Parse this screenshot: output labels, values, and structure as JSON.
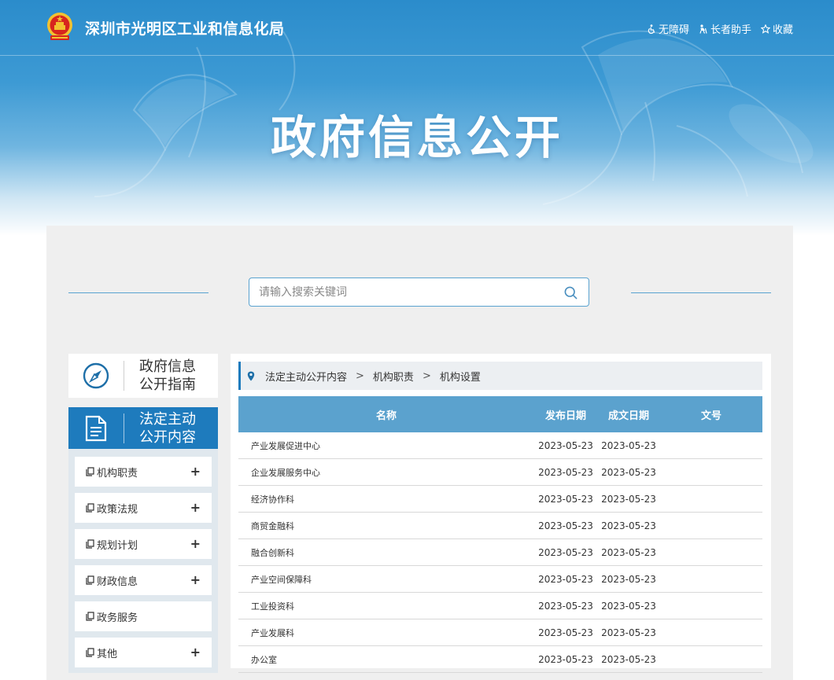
{
  "header": {
    "org_name": "深圳市光明区工业和信息化局",
    "links": [
      {
        "label": "无障碍",
        "icon": "accessibility-icon"
      },
      {
        "label": "长者助手",
        "icon": "elder-assistant-icon"
      },
      {
        "label": "收藏",
        "icon": "star-icon"
      }
    ],
    "hero_title": "政府信息公开"
  },
  "search": {
    "placeholder": "请输入搜索关键词",
    "value": ""
  },
  "sidebar": {
    "guide_card": {
      "line1": "政府信息",
      "line2": "公开指南",
      "icon": "compass-icon"
    },
    "active_card": {
      "line1": "法定主动",
      "line2": "公开内容",
      "icon": "document-icon"
    },
    "items": [
      {
        "label": "机构职责",
        "expandable": true
      },
      {
        "label": "政策法规",
        "expandable": true
      },
      {
        "label": "规划计划",
        "expandable": true
      },
      {
        "label": "财政信息",
        "expandable": true
      },
      {
        "label": "政务服务",
        "expandable": false
      },
      {
        "label": "其他",
        "expandable": true
      }
    ],
    "plus": "+"
  },
  "breadcrumb": [
    "法定主动公开内容",
    "机构职责",
    "机构设置"
  ],
  "table": {
    "columns": [
      "名称",
      "发布日期",
      "成文日期",
      "文号"
    ],
    "rows": [
      {
        "name": "产业发展促进中心",
        "publish": "2023-05-23",
        "written": "2023-05-23",
        "doc_no": ""
      },
      {
        "name": "企业发展服务中心",
        "publish": "2023-05-23",
        "written": "2023-05-23",
        "doc_no": ""
      },
      {
        "name": "经济协作科",
        "publish": "2023-05-23",
        "written": "2023-05-23",
        "doc_no": ""
      },
      {
        "name": "商贸金融科",
        "publish": "2023-05-23",
        "written": "2023-05-23",
        "doc_no": ""
      },
      {
        "name": "融合创新科",
        "publish": "2023-05-23",
        "written": "2023-05-23",
        "doc_no": ""
      },
      {
        "name": "产业空间保障科",
        "publish": "2023-05-23",
        "written": "2023-05-23",
        "doc_no": ""
      },
      {
        "name": "工业投资科",
        "publish": "2023-05-23",
        "written": "2023-05-23",
        "doc_no": ""
      },
      {
        "name": "产业发展科",
        "publish": "2023-05-23",
        "written": "2023-05-23",
        "doc_no": ""
      },
      {
        "name": "办公室",
        "publish": "2023-05-23",
        "written": "2023-05-23",
        "doc_no": ""
      }
    ]
  },
  "colors": {
    "brand_blue": "#1e7bbd",
    "table_header": "#5ba2ce",
    "panel_bg": "#efefef",
    "emblem_red": "#d7261e",
    "emblem_gold": "#f2c230"
  }
}
